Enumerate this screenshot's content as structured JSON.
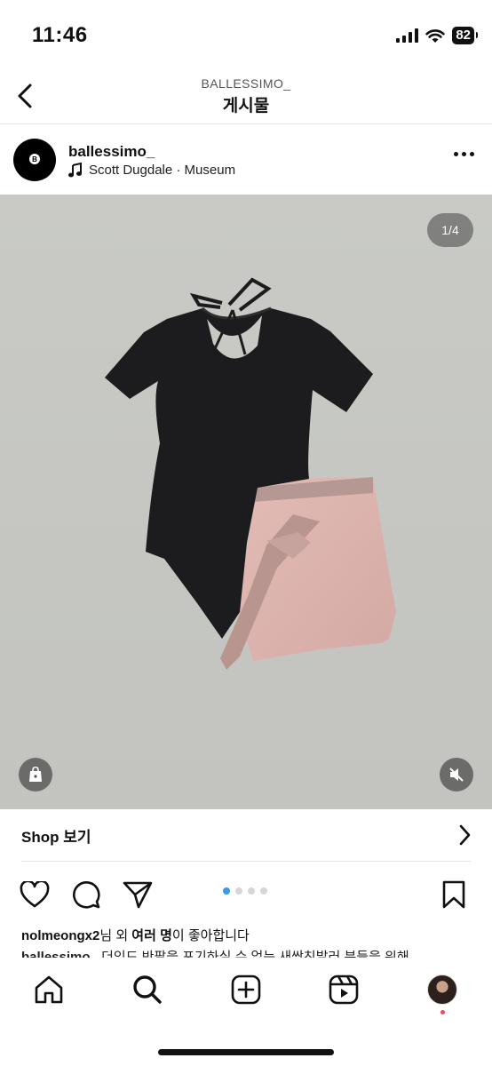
{
  "status_bar": {
    "time": "11:46",
    "battery": "82"
  },
  "header": {
    "account": "BALLESSIMO_",
    "title": "게시물"
  },
  "post": {
    "username": "ballessimo_",
    "avatar_label": "B",
    "music": "Scott Dugdale · Museum",
    "counter": "1/4",
    "carousel_total": 4,
    "carousel_index": 1
  },
  "shop": {
    "label": "Shop 보기"
  },
  "likes": {
    "user": "nolmeongx2",
    "mid": "님 외 ",
    "bold": "여러 명",
    "end": "이 좋아합니다"
  },
  "caption": {
    "user": "ballessimo_",
    "text": "더있드 반팔을 포기하실 수 없는 새싹친발러 분들을 위해"
  },
  "colors": {
    "accent": "#3897f0",
    "photo_bg": "#c8c9c5",
    "notification": "#ed4956"
  },
  "icons": {
    "back": "chevron-left-icon",
    "heart": "heart-icon",
    "comment": "comment-icon",
    "share": "send-icon",
    "save": "bookmark-icon",
    "home": "home-icon",
    "search": "search-icon",
    "create": "plus-square-icon",
    "reels": "reels-icon"
  }
}
